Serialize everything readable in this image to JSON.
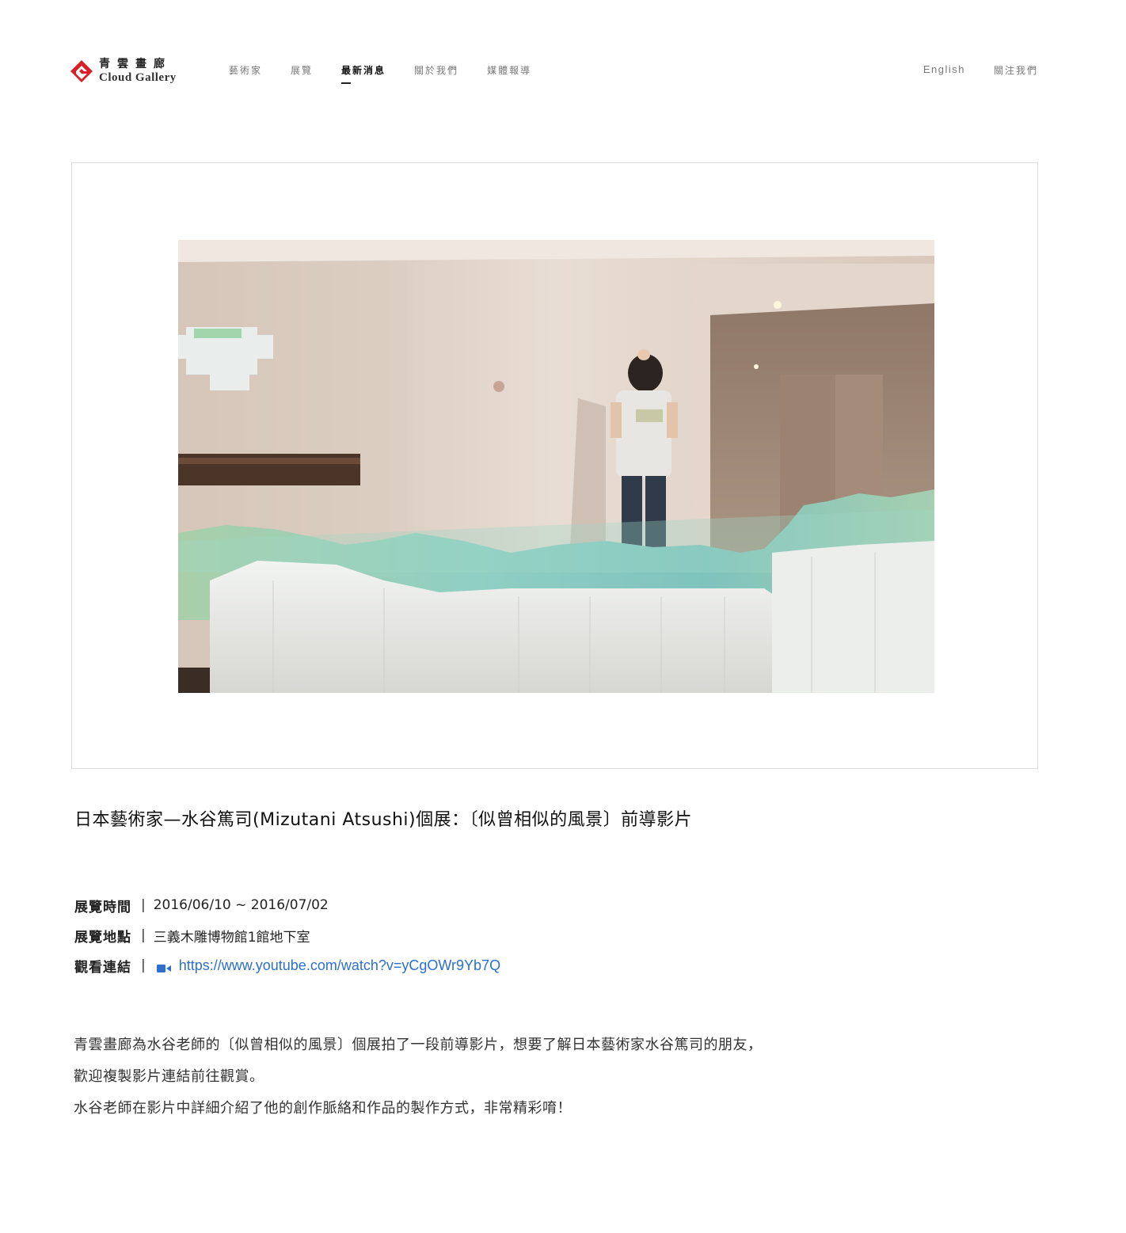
{
  "header": {
    "logo": {
      "cn": "青雲畫廊",
      "en": "Cloud Gallery"
    },
    "nav": [
      {
        "label": "藝術家"
      },
      {
        "label": "展覽"
      },
      {
        "label": "最新消息",
        "active": true
      },
      {
        "label": "關於我們"
      },
      {
        "label": "媒體報導"
      }
    ],
    "right": {
      "lang": "English",
      "follow": "關注我們"
    }
  },
  "colors": {
    "link": "#2c6fd1",
    "brand": "#d6202a"
  },
  "post": {
    "title": "日本藝術家—水谷篤司(Mizutani Atsushi)個展：〔似曾相似的風景〕前導影片",
    "info": {
      "date_label": "展覽時間",
      "date_value": "2016/06/10 ~ 2016/07/02",
      "place_label": "展覽地點",
      "place_value": "三義木雕博物館1館地下室",
      "link_label": "觀看連結",
      "link_icon": "video-camera-icon",
      "link_value": "https://www.youtube.com/watch?v=yCgOWr9Yb7Q",
      "separator": "|"
    },
    "body": [
      "青雲畫廊為水谷老師的〔似曾相似的風景〕個展拍了一段前導影片，想要了解日本藝術家水谷篤司的朋友，",
      "歡迎複製影片連結前往觀賞。",
      "水谷老師在影片中詳細介紹了他的創作脈絡和作品的製作方式，非常精彩唷！"
    ]
  }
}
